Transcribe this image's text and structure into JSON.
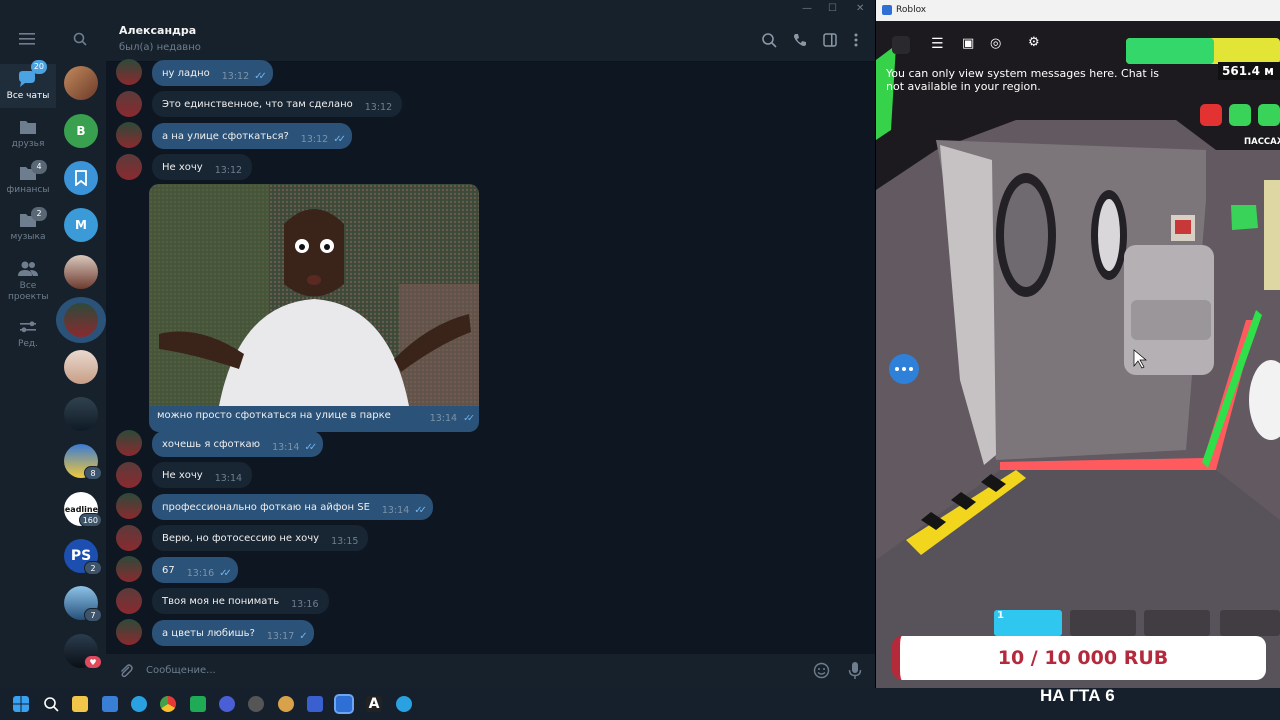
{
  "telegram": {
    "header": {
      "name": "Александра",
      "status": "был(а) недавно"
    },
    "rail": [
      {
        "label": "Все чаты",
        "badge": "20",
        "active": true
      },
      {
        "label": "друзья",
        "badge": ""
      },
      {
        "label": "финансы",
        "badge": "4"
      },
      {
        "label": "музыка",
        "badge": "2"
      },
      {
        "label": "Все проекты",
        "badge": ""
      },
      {
        "label": "Ред.",
        "badge": ""
      }
    ],
    "chat_list": [
      {
        "letter": "",
        "badge": ""
      },
      {
        "letter": "B",
        "badge": ""
      },
      {
        "letter": "",
        "badge": ""
      },
      {
        "letter": "M",
        "badge": ""
      },
      {
        "letter": "",
        "badge": ""
      },
      {
        "letter": "",
        "badge": ""
      },
      {
        "letter": "",
        "badge": ""
      },
      {
        "letter": "",
        "badge": ""
      },
      {
        "letter": "",
        "badge": "8"
      },
      {
        "letter": "headlines",
        "badge": "160"
      },
      {
        "letter": "PS",
        "badge": "2"
      },
      {
        "letter": "",
        "badge": "7"
      },
      {
        "letter": "",
        "badge": "♥"
      }
    ],
    "messages": [
      {
        "text": "ну ладно",
        "time": "13:12",
        "dir": "out"
      },
      {
        "text": "Это единственное, что там сделано",
        "time": "13:12",
        "dir": "in"
      },
      {
        "text": "а на улице сфоткаться?",
        "time": "13:12",
        "dir": "out"
      },
      {
        "text": "Не хочу",
        "time": "13:12",
        "dir": "in"
      },
      {
        "text": "можно просто сфоткаться на улице в парке",
        "time": "13:14",
        "dir": "out"
      },
      {
        "text": "хочешь я сфоткаю",
        "time": "13:14",
        "dir": "out"
      },
      {
        "text": "Не хочу",
        "time": "13:14",
        "dir": "in"
      },
      {
        "text": "профессионально фоткаю на айфон SE",
        "time": "13:14",
        "dir": "out"
      },
      {
        "text": "Верю, но фотосессию не хочу",
        "time": "13:15",
        "dir": "in"
      },
      {
        "text": "67",
        "time": "13:16",
        "dir": "out"
      },
      {
        "text": "Твоя моя не понимать",
        "time": "13:16",
        "dir": "in"
      },
      {
        "text": "а цветы любишь?",
        "time": "13:17",
        "dir": "out"
      }
    ],
    "input_placeholder": "Сообщение..."
  },
  "roblox": {
    "window_title": "Roblox",
    "system_message": "You can only view system messages here. Chat is not available in your region.",
    "distance": "561.4 м",
    "passenger_label": "ПАССАЖ",
    "hotbar_slot": "1",
    "counter": "10 / 10 000 RUB",
    "banner": "НА ГТА 6"
  },
  "colors": {
    "tg_bg": "#0e1621",
    "bubble_out": "#2b5278",
    "bubble_in": "#182533",
    "accent": "#4ba3e2"
  }
}
